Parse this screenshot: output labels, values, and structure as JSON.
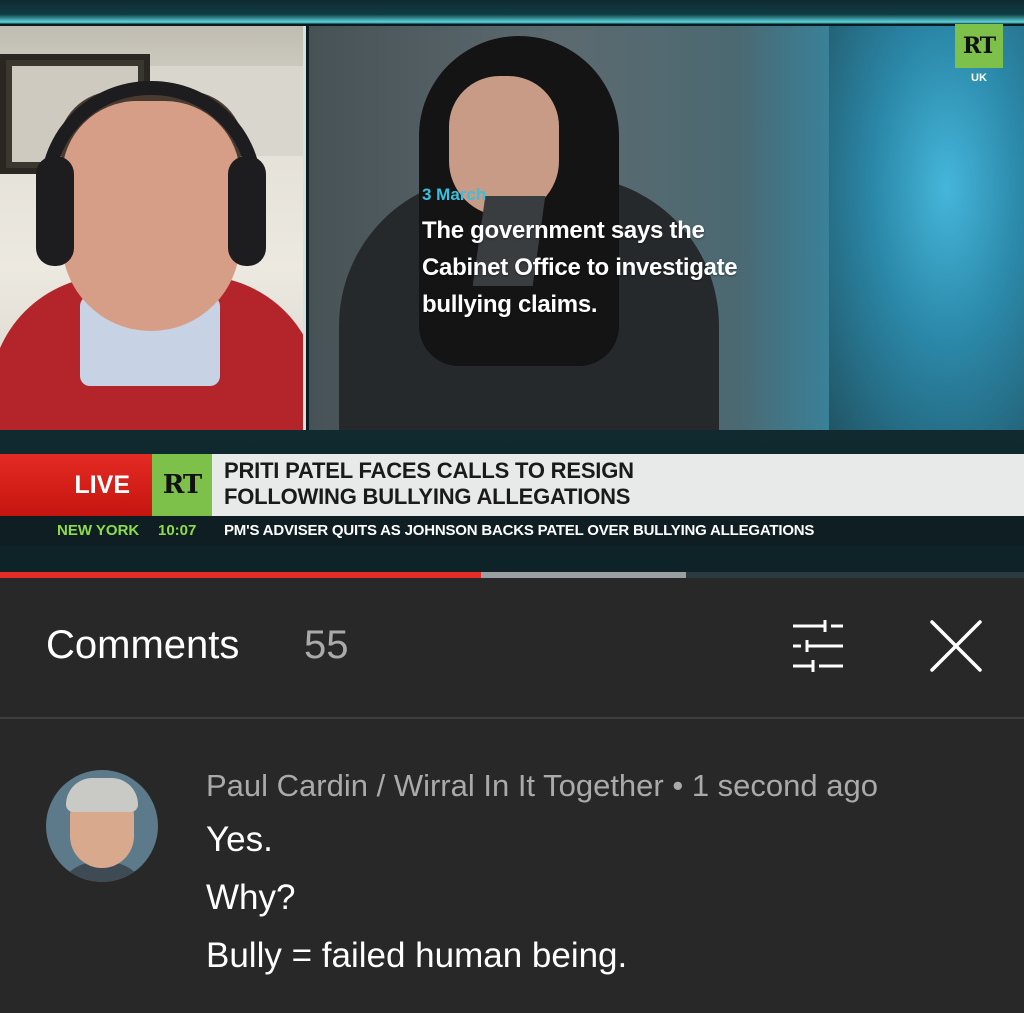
{
  "video": {
    "channel_logo": "RT",
    "channel_region": "UK",
    "caption_date": "3 March",
    "caption_lines": [
      "The government says the",
      "Cabinet Office to investigate",
      "bullying claims."
    ],
    "live_label": "LIVE",
    "band_logo": "RT",
    "headline_lines": [
      "PRITI PATEL FACES CALLS TO RESIGN",
      "FOLLOWING BULLYING ALLEGATIONS"
    ],
    "ticker_city": "NEW YORK",
    "ticker_time": "10:07",
    "ticker_text": "PM'S ADVISER QUITS AS JOHNSON BACKS PATEL OVER BULLYING ALLEGATIONS",
    "progress_played_fraction": 0.47,
    "progress_buffered_fraction": 0.67,
    "colors": {
      "played": "#e52d27",
      "live_red": "#e42b23",
      "rt_green": "#7dc04a",
      "caption_accent": "#36c2e0"
    }
  },
  "comments": {
    "title": "Comments",
    "count": "55",
    "filter_icon": "sliders-icon",
    "close_icon": "close-icon",
    "items": [
      {
        "author": "Paul Cardin / Wirral In It Together",
        "separator": " • ",
        "time": "1 second ago",
        "lines": [
          "Yes.",
          "Why?",
          "Bully = failed human being."
        ]
      }
    ]
  }
}
